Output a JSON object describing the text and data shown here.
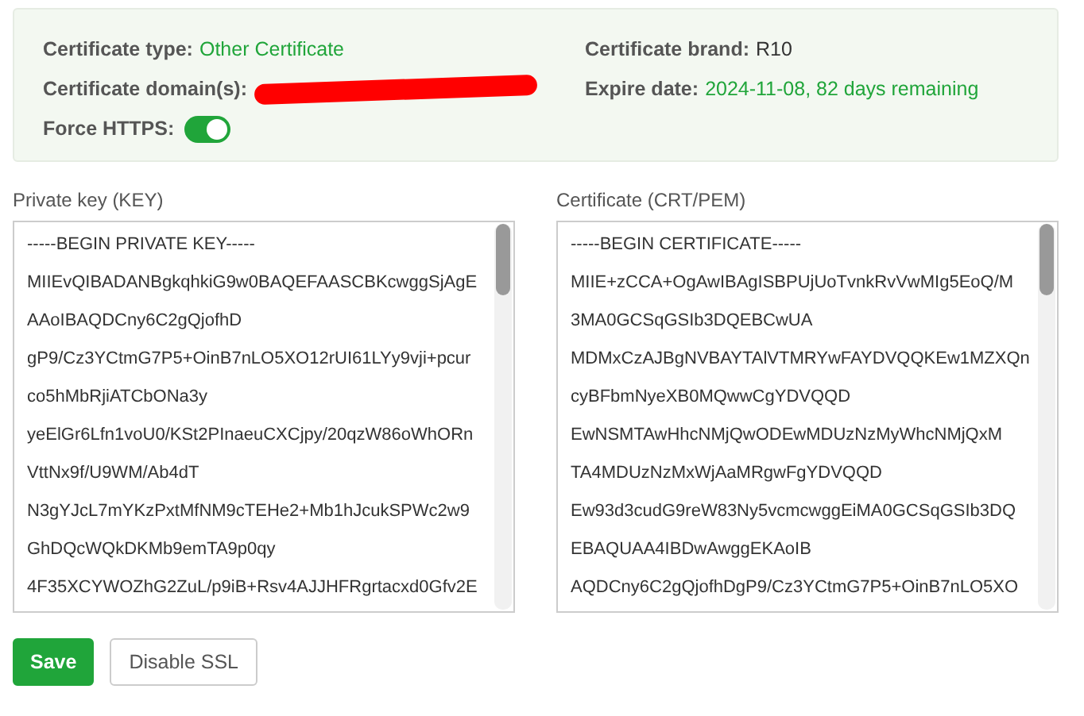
{
  "info": {
    "certificate_type": {
      "label": "Certificate type:",
      "value": "Other Certificate"
    },
    "certificate_domains": {
      "label": "Certificate domain(s):",
      "redacted": true
    },
    "force_https": {
      "label": "Force HTTPS:",
      "on": true
    },
    "certificate_brand": {
      "label": "Certificate brand:",
      "value": "R10"
    },
    "expire_date": {
      "label": "Expire date:",
      "value": "2024-11-08, 82 days remaining"
    }
  },
  "fields": [
    {
      "label": "Private key (KEY)",
      "lines": [
        "-----BEGIN PRIVATE KEY-----",
        "MIIEvQIBADANBgkqhkiG9w0BAQEFAASCBKcwggSjAgE",
        "AAoIBAQDCny6C2gQjofhD",
        "gP9/Cz3YCtmG7P5+OinB7nLO5XO12rUI61LYy9vji+pcur",
        "co5hMbRjiATCbONa3y",
        "yeElGr6Lfn1voU0/KSt2PInaeuCXCjpy/20qzW86oWhORn",
        "VttNx9f/U9WM/Ab4dT",
        "N3gYJcL7mYKzPxtMfNM9cTEHe2+Mb1hJcukSPWc2w9",
        "GhDQcWQkDKMb9emTA9p0qy",
        "4F35XCYWOZhG2ZuL/p9iB+Rsv4AJJHFRgrtacxd0Gfv2E"
      ]
    },
    {
      "label": "Certificate (CRT/PEM)",
      "lines": [
        "-----BEGIN CERTIFICATE-----",
        "MIIE+zCCA+OgAwIBAgISBPUjUoTvnkRvVwMIg5EoQ/M",
        "3MA0GCSqGSIb3DQEBCwUA",
        "MDMxCzAJBgNVBAYTAlVTMRYwFAYDVQQKEw1MZXQn",
        "cyBFbmNyeXB0MQwwCgYDVQQD",
        "EwNSMTAwHhcNMjQwODEwMDUzNzMyWhcNMjQxM",
        "TA4MDUzNzMxWjAaMRgwFgYDVQQD",
        "Ew93d3cudG9reW83Ny5vcmcwggEiMA0GCSqGSIb3DQ",
        "EBAQUAA4IBDwAwggEKAoIB",
        "AQDCny6C2gQjofhDgP9/Cz3YCtmG7P5+OinB7nLO5XO"
      ]
    }
  ],
  "buttons": [
    {
      "label": "Save",
      "kind": "primary"
    },
    {
      "label": "Disable SSL",
      "kind": "default"
    }
  ]
}
